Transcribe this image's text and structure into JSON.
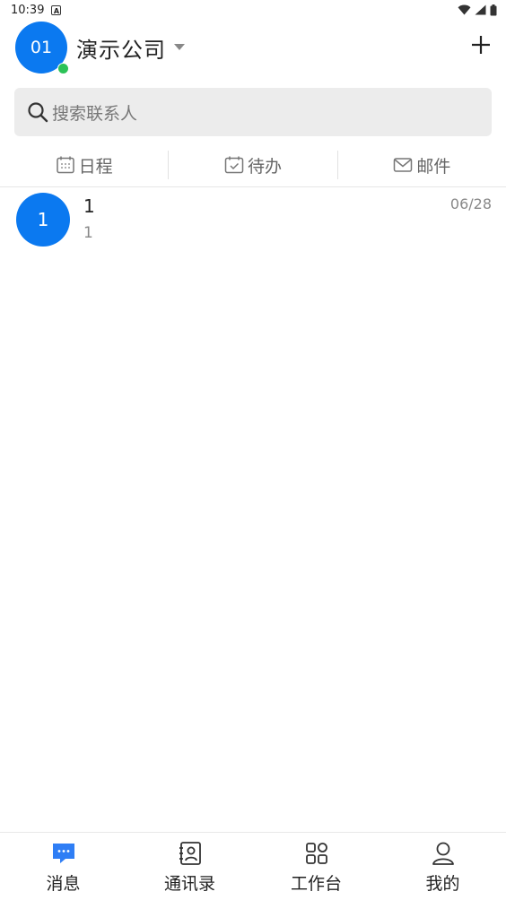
{
  "status_bar": {
    "time": "10:39",
    "notification_icon": "a-notification-icon",
    "icons": [
      "wifi-icon",
      "cellular-signal-icon",
      "battery-icon"
    ]
  },
  "header": {
    "avatar_text": "01",
    "org_name": "演示公司",
    "online_status_color": "#2cc257",
    "add_icon": "plus-icon"
  },
  "search": {
    "placeholder": "搜索联系人"
  },
  "shortcuts": [
    {
      "label": "日程",
      "icon": "calendar-icon"
    },
    {
      "label": "待办",
      "icon": "todo-check-icon"
    },
    {
      "label": "邮件",
      "icon": "mail-icon"
    }
  ],
  "conversations": [
    {
      "avatar_text": "1",
      "title": "1",
      "preview": "1",
      "time": "06/28"
    }
  ],
  "bottom_nav": [
    {
      "label": "消息",
      "icon": "chat-bubble-icon",
      "active": true
    },
    {
      "label": "通讯录",
      "icon": "contacts-book-icon",
      "active": false
    },
    {
      "label": "工作台",
      "icon": "grid-apps-icon",
      "active": false
    },
    {
      "label": "我的",
      "icon": "user-profile-icon",
      "active": false
    }
  ],
  "colors": {
    "accent": "#0b79f0",
    "online": "#2cc257",
    "search_bg": "#ececec"
  }
}
